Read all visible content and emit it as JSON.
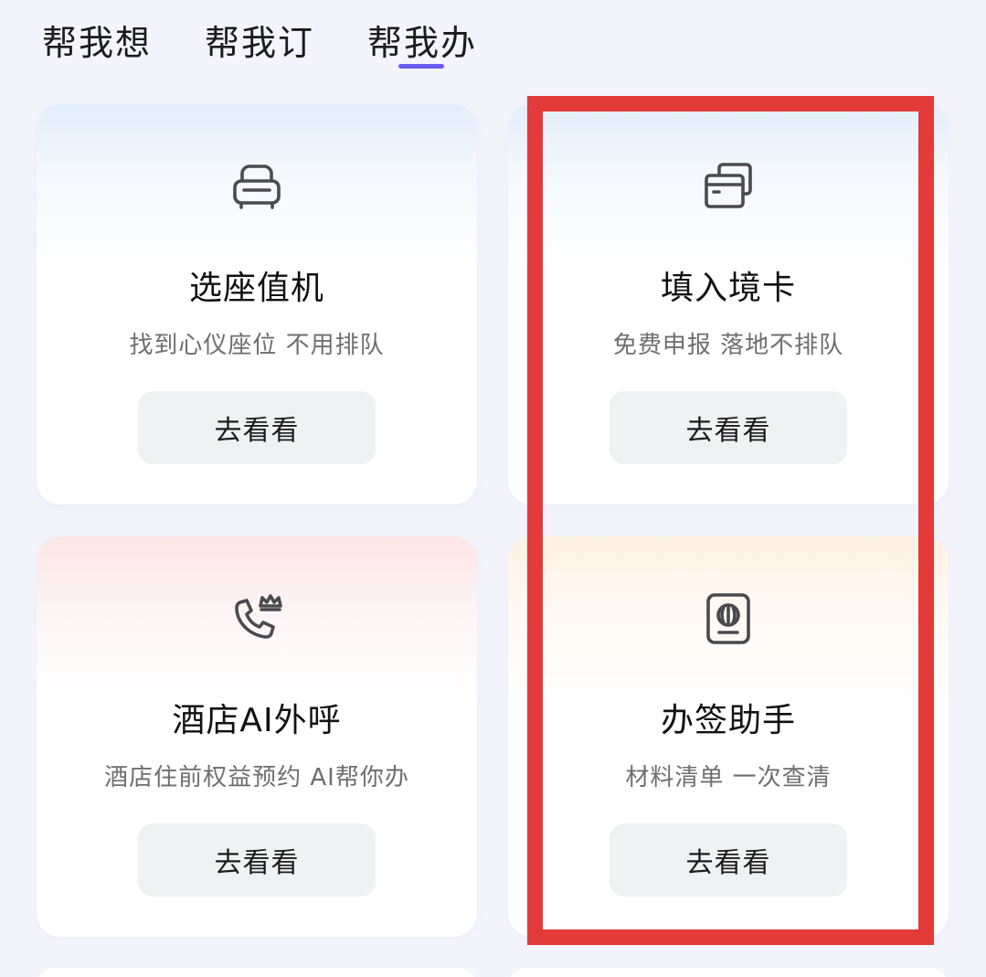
{
  "tabs": [
    {
      "label": "帮我想"
    },
    {
      "label": "帮我订"
    },
    {
      "label": "帮我办",
      "selected": true
    }
  ],
  "accent_color": "#6a5cf0",
  "highlight_color": "#e23b39",
  "cards": [
    {
      "icon": "seat-icon",
      "title": "选座值机",
      "subtitle": "找到心仪座位 不用排队",
      "button": "去看看"
    },
    {
      "icon": "entry-card-icon",
      "title": "填入境卡",
      "subtitle": "免费申报 落地不排队",
      "button": "去看看"
    },
    {
      "icon": "phone-crown-icon",
      "title": "酒店AI外呼",
      "subtitle": "酒店住前权益预约 AI帮你办",
      "button": "去看看"
    },
    {
      "icon": "passport-icon",
      "title": "办签助手",
      "subtitle": "材料清单 一次查清",
      "button": "去看看"
    }
  ]
}
